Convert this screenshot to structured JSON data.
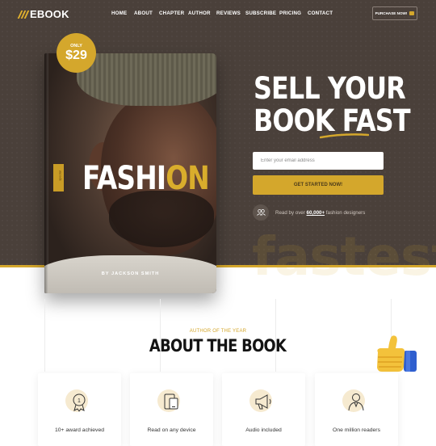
{
  "brand": {
    "name": "EBOOK"
  },
  "nav": {
    "items": [
      "HOME",
      "ABOUT",
      "CHAPTER",
      "AUTHOR",
      "REVIEWS",
      "SUBSCRIBE",
      "PRICING",
      "CONTACT"
    ],
    "purchase_label": "PURCHASE NOW!"
  },
  "price": {
    "only": "ONLY",
    "value": "$29"
  },
  "book": {
    "title_main": "FASHI",
    "title_accent": "ON",
    "side_tag": "special",
    "author": "BY JACKSON SMITH"
  },
  "hero": {
    "headline_line1": "SELL YOUR",
    "headline_line2": "BOOK FAST",
    "email_placeholder": "Enter your email address",
    "cta_label": "GET STARTED NOW!",
    "readers_prefix": "Read by over ",
    "readers_count": "60,000+",
    "readers_suffix": " fashion designers",
    "watermark": "fastest"
  },
  "about": {
    "kicker": "AUTHOR OF THE YEAR",
    "title": "ABOUT THE BOOK"
  },
  "features": [
    {
      "label": "10+ award achieved",
      "icon": "award-icon"
    },
    {
      "label": "Read on any device",
      "icon": "devices-icon"
    },
    {
      "label": "Audio included",
      "icon": "megaphone-icon"
    },
    {
      "label": "One million readers",
      "icon": "reader-icon"
    }
  ],
  "colors": {
    "accent": "#d4a72c",
    "hero_bg": "#4a403a"
  }
}
